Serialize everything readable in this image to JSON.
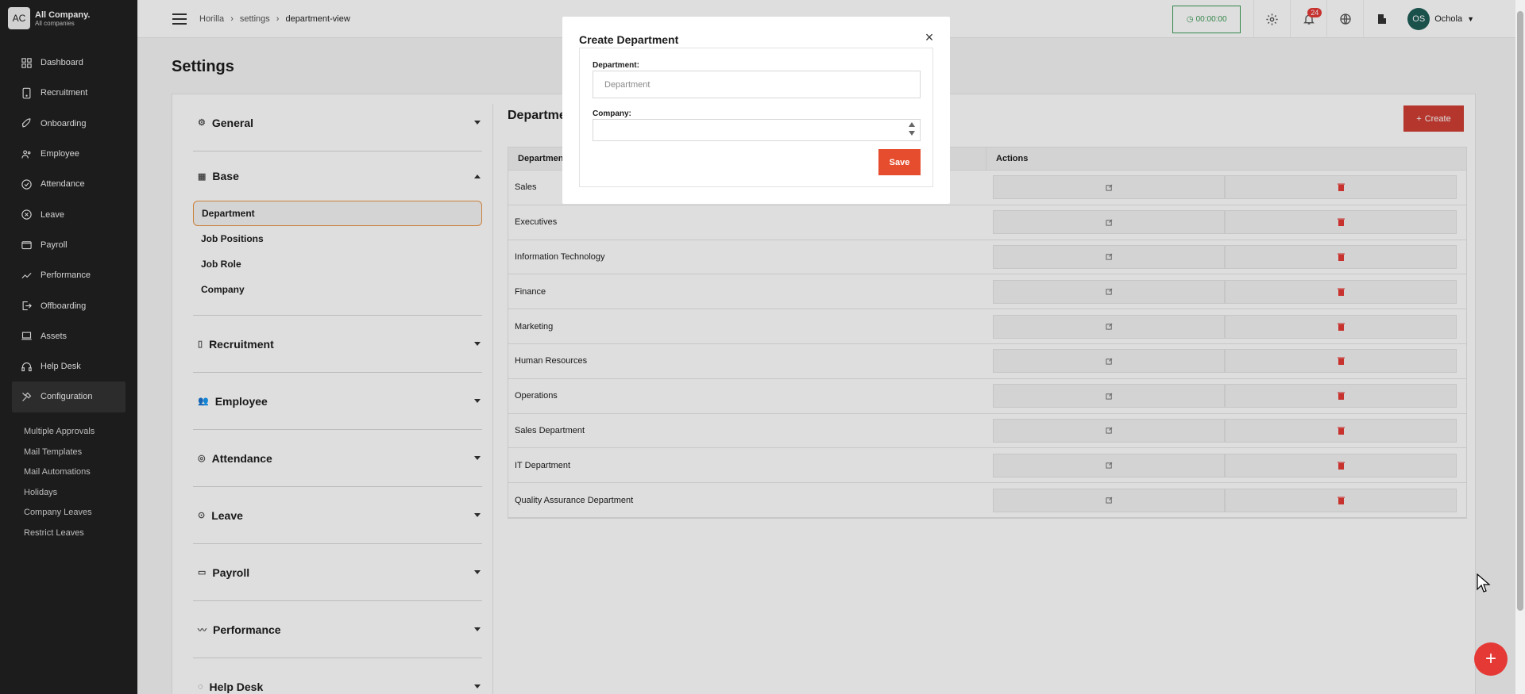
{
  "brand": {
    "logo": "AC",
    "name": "All Company.",
    "sub": "All companies"
  },
  "sidebar": {
    "items": [
      {
        "label": "Dashboard",
        "icon": "dashboard-icon"
      },
      {
        "label": "Recruitment",
        "icon": "recruitment-icon"
      },
      {
        "label": "Onboarding",
        "icon": "rocket-icon"
      },
      {
        "label": "Employee",
        "icon": "people-icon"
      },
      {
        "label": "Attendance",
        "icon": "check-circle-icon"
      },
      {
        "label": "Leave",
        "icon": "x-circle-icon"
      },
      {
        "label": "Payroll",
        "icon": "wallet-icon"
      },
      {
        "label": "Performance",
        "icon": "trend-icon"
      },
      {
        "label": "Offboarding",
        "icon": "exit-icon"
      },
      {
        "label": "Assets",
        "icon": "laptop-icon"
      },
      {
        "label": "Help Desk",
        "icon": "headset-icon"
      },
      {
        "label": "Configuration",
        "icon": "tools-icon"
      }
    ],
    "sub_items": [
      "Multiple Approvals",
      "Mail Templates",
      "Mail Automations",
      "Holidays",
      "Company Leaves",
      "Restrict Leaves"
    ]
  },
  "header": {
    "breadcrumb": [
      "Horilla",
      "settings",
      "department-view"
    ],
    "timer": "00:00:00",
    "notifications": "24",
    "user_initials": "OS",
    "user_name": "Ochola"
  },
  "page_title": "Settings",
  "settings_nav": {
    "sections_top": [
      "General"
    ],
    "base_label": "Base",
    "base_items": [
      "Department",
      "Job Positions",
      "Job Role",
      "Company"
    ],
    "sections_bottom": [
      "Recruitment",
      "Employee",
      "Attendance",
      "Leave",
      "Payroll",
      "Performance",
      "Help Desk"
    ]
  },
  "content": {
    "title": "Department",
    "create_label": "Create",
    "col_department": "Department",
    "col_actions": "Actions",
    "rows": [
      "Sales",
      "Executives",
      "Information Technology",
      "Finance",
      "Marketing",
      "Human Resources",
      "Operations",
      "Sales Department",
      "IT Department",
      "Quality Assurance Department"
    ]
  },
  "modal": {
    "title": "Create Department",
    "department_label": "Department:",
    "department_placeholder": "Department",
    "company_label": "Company:",
    "save_label": "Save"
  },
  "colors": {
    "accent": "#e54d2e",
    "sidebar": "#212121",
    "timer": "#3c9a55"
  }
}
